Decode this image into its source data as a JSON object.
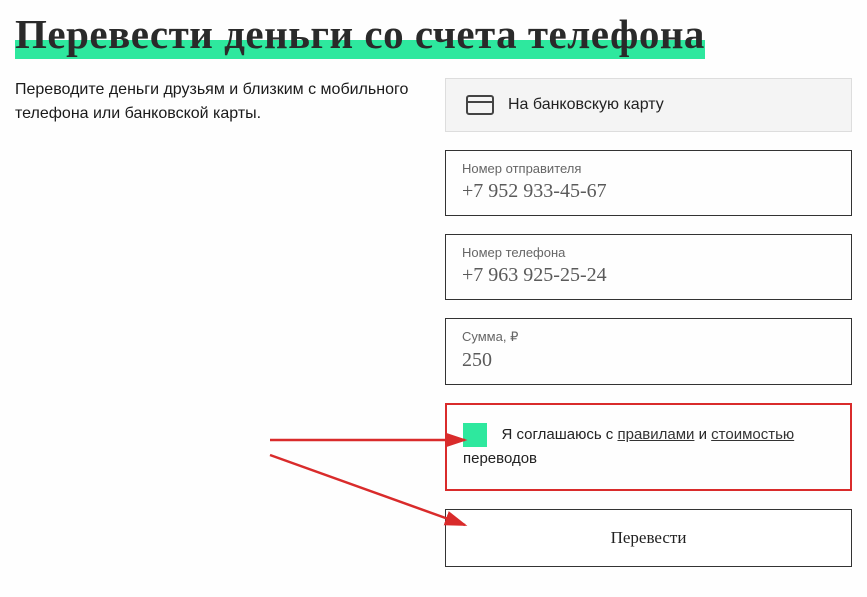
{
  "title": "Перевести деньги со счета телефона",
  "description": "Переводите деньги друзьям и близким с мобильного телефона или банковской карты.",
  "tab": {
    "card_label": "На банковскую карту"
  },
  "fields": {
    "sender": {
      "label": "Номер отправителя",
      "value": "+7 952 933-45-67"
    },
    "phone": {
      "label": "Номер телефона",
      "value": "+7 963 925-25-24"
    },
    "amount": {
      "label": "Сумма, ₽",
      "value": "250"
    }
  },
  "consent": {
    "prefix": "Я соглашаюсь с ",
    "rules_link": "правилами",
    "mid": " и ",
    "cost_link": "стоимостью",
    "suffix": " переводов"
  },
  "submit_label": "Перевести"
}
